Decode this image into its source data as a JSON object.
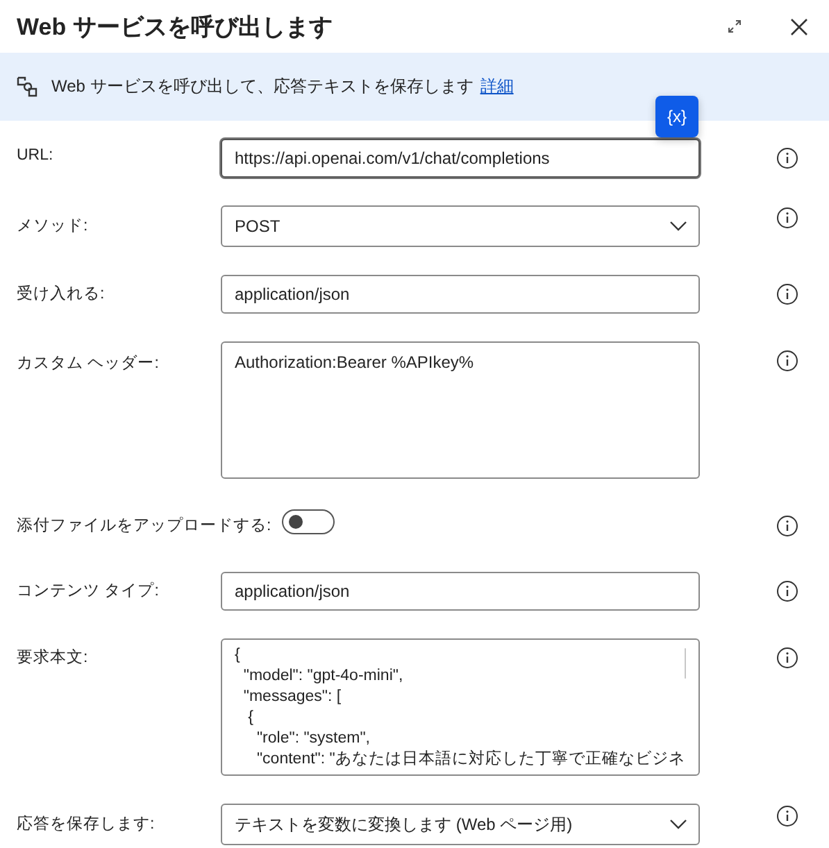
{
  "window": {
    "title": "Web サービスを呼び出します"
  },
  "banner": {
    "text": "Web サービスを呼び出して、応答テキストを保存します",
    "link": "詳細"
  },
  "variables_button": {
    "label": "{x}"
  },
  "fields": [
    {
      "kind": "text",
      "label": "URL:",
      "value": "https://api.openai.com/v1/chat/completions",
      "focused": true
    },
    {
      "kind": "dropdown",
      "label": "メソッド:",
      "value": "POST"
    },
    {
      "kind": "text",
      "label": "受け入れる:",
      "value": "application/json",
      "focused": false
    },
    {
      "kind": "textarea",
      "label": "カスタム ヘッダー:",
      "value": "Authorization:Bearer %APIkey%"
    },
    {
      "kind": "toggle",
      "label": "添付ファイルをアップロードする:",
      "on": false
    },
    {
      "kind": "text",
      "label": "コンテンツ タイプ:",
      "value": "application/json",
      "focused": false
    },
    {
      "kind": "code",
      "label": "要求本文:",
      "lines": [
        "{",
        "  \"model\": \"gpt-4o-mini\",",
        "  \"messages\": [",
        "   {",
        "     \"role\": \"system\",",
        "     \"content\": \"あなたは日本語に対応した丁寧で正確なビジネ"
      ]
    },
    {
      "kind": "dropdown",
      "label": "応答を保存します:",
      "value": "テキストを変数に変換します (Web ページ用)"
    }
  ]
}
